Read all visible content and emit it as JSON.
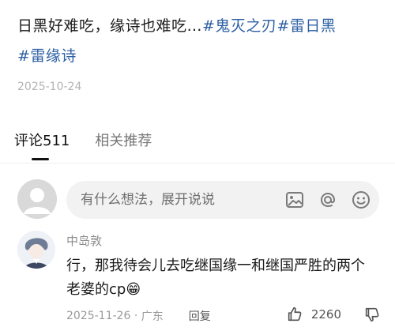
{
  "post": {
    "text": "日黑好难吃，缘诗也难吃…",
    "tag1": "#鬼灭之刃",
    "tag2": "#雷日黑",
    "tag3": "#雷缘诗",
    "date": "2025-10-24"
  },
  "tabs": [
    {
      "label": "评论511"
    },
    {
      "label": "相关推荐"
    }
  ],
  "comment_input": {
    "placeholder": "有什么想法，展开说说"
  },
  "comment": {
    "user_name": "中岛敦",
    "text": "行，那我待会儿去吃继国缘一和继国严胜的两个老婆的cp",
    "emoji": "😁",
    "date": "2025-11-26",
    "location": "广东",
    "reply_label": "回复",
    "like_count": "2260"
  },
  "colors": {
    "tag": "#2d5fa3",
    "muted": "#9a9a9a",
    "input_bg": "#f2f2f2"
  },
  "icons": [
    "image-icon",
    "at-icon",
    "emoji-icon",
    "like-icon",
    "dislike-icon"
  ]
}
